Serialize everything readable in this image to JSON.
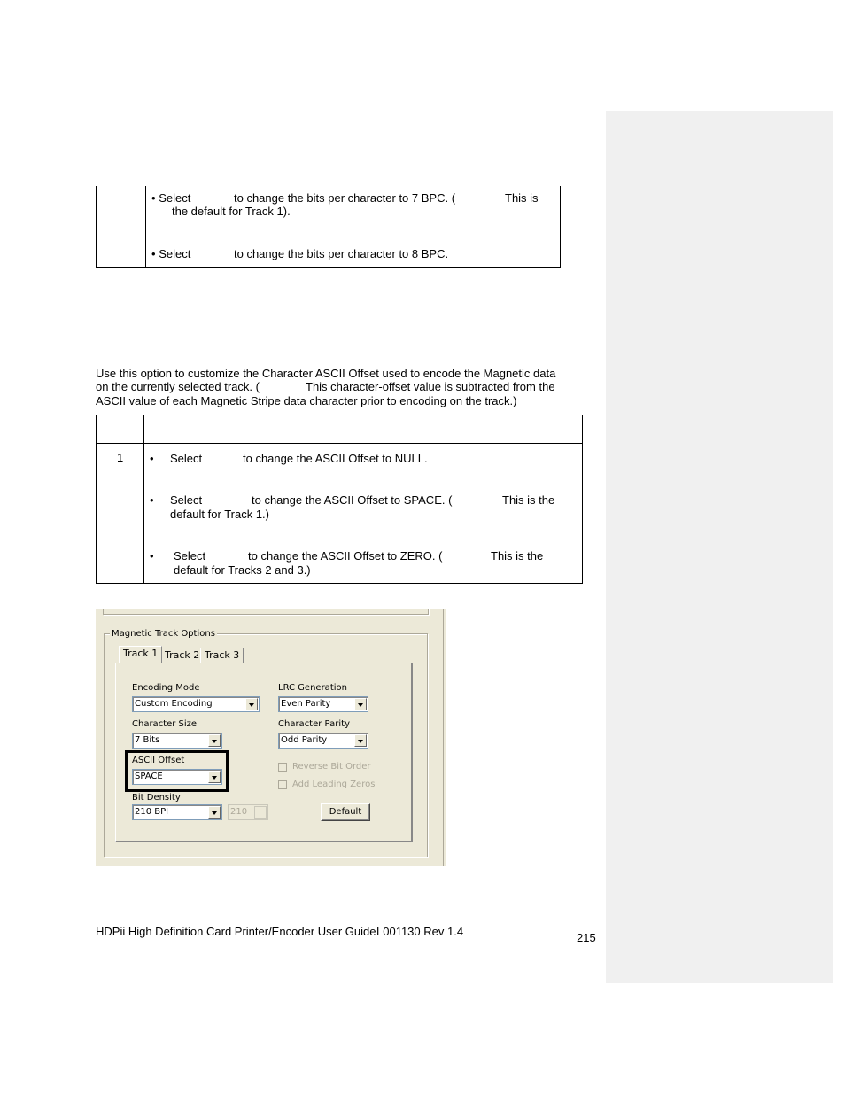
{
  "table1": {
    "row_bullets": [
      {
        "line1_a": "Select",
        "line1_b": "to change the bits per character to 7 BPC. (",
        "line1_c": "This is",
        "line2": "the default for Track 1)."
      },
      {
        "line1_a": "Select",
        "line1_b": "to change the bits per character to 8 BPC."
      }
    ]
  },
  "intro": {
    "line1": "Use this option to customize the Character ASCII Offset used to encode the Magnetic data",
    "line2_a": "on the currently selected track. (",
    "line2_b": "This character-offset value is subtracted from the",
    "line3": "ASCII value of each Magnetic Stripe data character prior to encoding on the track.)"
  },
  "table2": {
    "step": "1",
    "bullets": [
      {
        "a": "Select",
        "b": "to change the ASCII Offset to NULL."
      },
      {
        "a": "Select",
        "b": "to change the ASCII Offset to SPACE. (",
        "c": "This is the",
        "line2": "default for Track 1.)"
      },
      {
        "a": "Select",
        "b": "to change the ASCII Offset to ZERO. (",
        "c": "This is the",
        "line2": "default for Tracks 2 and 3.)"
      }
    ]
  },
  "dialog": {
    "group_label": "Magnetic Track Options",
    "tabs": [
      "Track 1",
      "Track 2",
      "Track 3"
    ],
    "active_tab": "Track 1",
    "encoding_mode": {
      "label": "Encoding Mode",
      "value": "Custom Encoding"
    },
    "lrc_generation": {
      "label": "LRC Generation",
      "value": "Even Parity"
    },
    "character_size": {
      "label": "Character Size",
      "value": "7 Bits"
    },
    "character_parity": {
      "label": "Character Parity",
      "value": "Odd Parity"
    },
    "ascii_offset": {
      "label": "ASCII Offset",
      "value": "SPACE"
    },
    "reverse_bit_order": {
      "label": "Reverse Bit Order",
      "checked": false,
      "enabled": false
    },
    "add_leading_zeros": {
      "label": "Add Leading Zeros",
      "checked": false,
      "enabled": false
    },
    "bit_density": {
      "label": "Bit Density",
      "value": "210 BPI",
      "spin_value": "210"
    },
    "default_button": "Default"
  },
  "footer": {
    "title": "HDPii High Definition Card Printer/Encoder User Guide",
    "doc_id": "L001130 Rev 1.4",
    "page_number": "215"
  }
}
